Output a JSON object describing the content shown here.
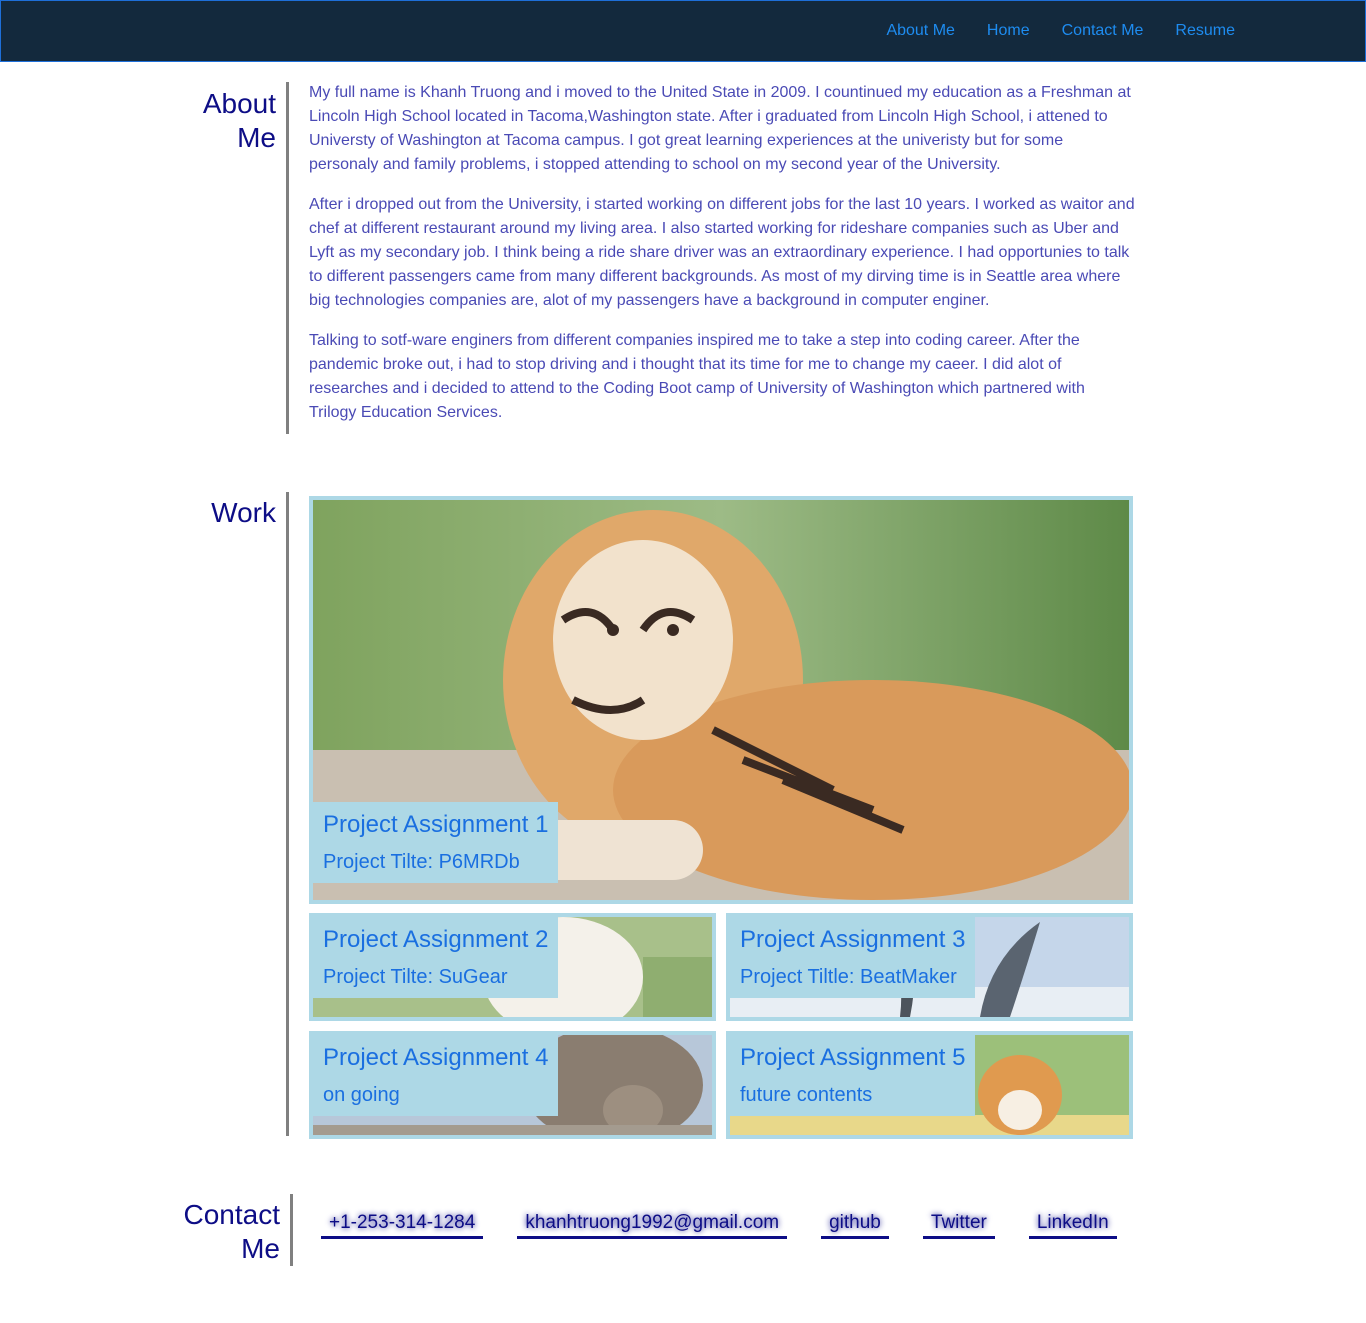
{
  "nav": {
    "items": [
      {
        "label": "About Me"
      },
      {
        "label": "Home"
      },
      {
        "label": "Contact Me"
      },
      {
        "label": "Resume"
      }
    ]
  },
  "about": {
    "title": "About Me",
    "paragraphs": [
      "My full name is Khanh Truong and i moved to the United State in 2009. I countinued my education as a Freshman at Lincoln High School located in Tacoma,Washington state. After i graduated from Lincoln High School, i attened to Universty of Washington at Tacoma campus. I got great learning experiences at the univeristy but for some personaly and family problems, i stopped attending to school on my second year of the University.",
      "After i dropped out from the University, i started working on different jobs for the last 10 years. I worked as waitor and chef at different restaurant around my living area. I also started working for rideshare companies such as Uber and Lyft as my secondary job. I think being a ride share driver was an extraordinary experience. I had opportunies to talk to different passengers came from many different backgrounds. As most of my dirving time is in Seattle area where big technologies companies are, alot of my passengers have a background in computer enginer.",
      "Talking to sotf-ware enginers from different companies inspired me to take a step into coding career. After the pandemic broke out, i had to stop driving and i thought that its time for me to change my caeer. I did alot of researches and i decided to attend to the Coding Boot camp of University of Washington which partnered with Trilogy Education Services."
    ]
  },
  "work": {
    "title": "Work",
    "projects": [
      {
        "title": "Project Assignment 1",
        "subtitle": "Project Tilte: P6MRDb",
        "image": "tiger"
      },
      {
        "title": "Project Assignment 2",
        "subtitle": "Project Tilte: SuGear",
        "image": "goat"
      },
      {
        "title": "Project Assignment 3",
        "subtitle": "Project Tiltle: BeatMaker",
        "image": "dolphin"
      },
      {
        "title": "Project Assignment 4",
        "subtitle": "on going",
        "image": "elephants"
      },
      {
        "title": "Project Assignment 5",
        "subtitle": "future contents",
        "image": "corgi"
      }
    ]
  },
  "contact": {
    "title": "Contact Me",
    "links": [
      {
        "label": "+1-253-314-1284"
      },
      {
        "label": "khanhtruong1992@gmail.com"
      },
      {
        "label": "github"
      },
      {
        "label": "Twitter"
      },
      {
        "label": "LinkedIn"
      }
    ]
  },
  "colors": {
    "header_bg": "#13293d",
    "nav_link": "#1e8cf0",
    "heading": "#0d0d86",
    "body_text": "#4a4ab5",
    "card_border": "#add8e6",
    "caption_text": "#1a6fe0"
  }
}
